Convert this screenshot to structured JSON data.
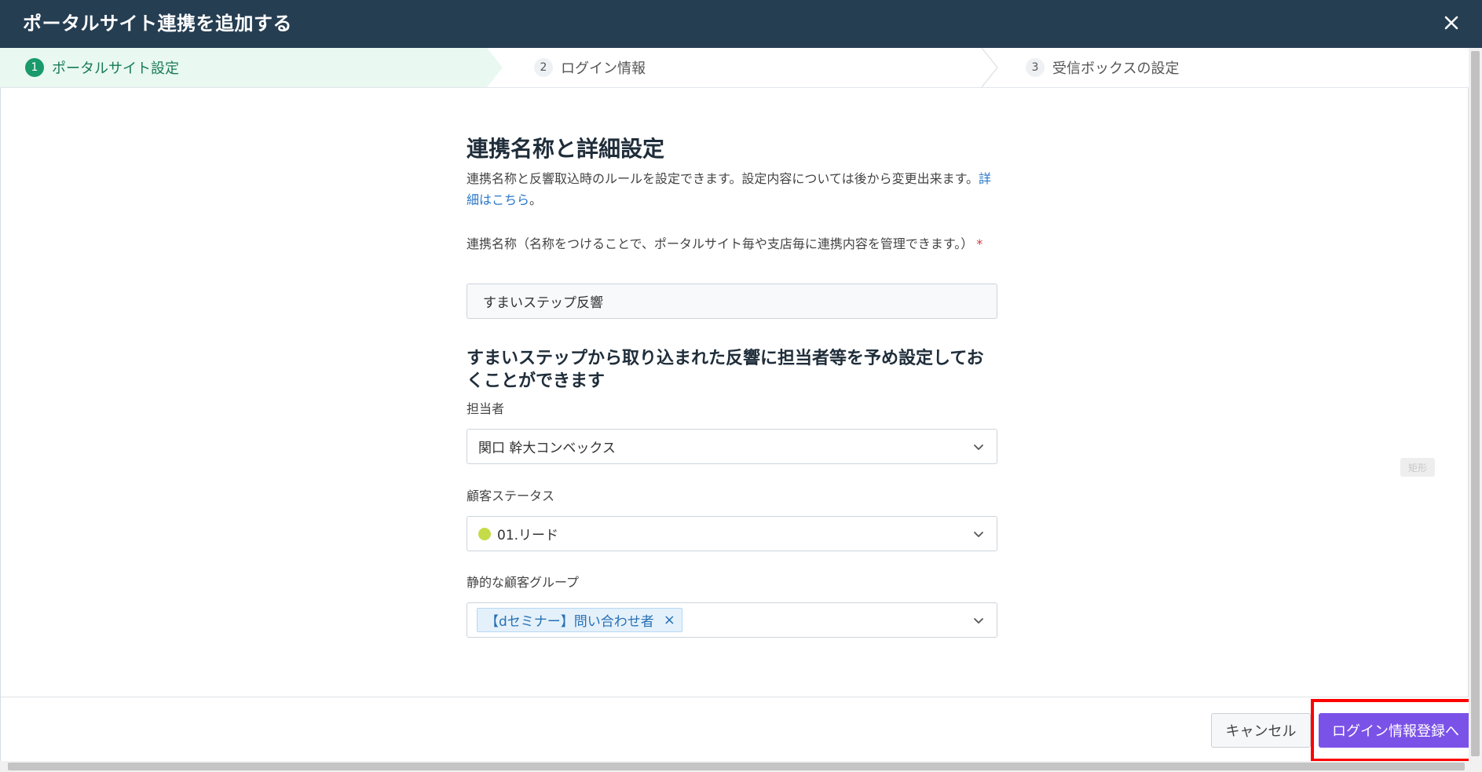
{
  "header": {
    "title": "ポータルサイト連携を追加する"
  },
  "stepper": {
    "steps": [
      {
        "number": "1",
        "label": "ポータルサイト設定"
      },
      {
        "number": "2",
        "label": "ログイン情報"
      },
      {
        "number": "3",
        "label": "受信ボックスの設定"
      }
    ]
  },
  "form": {
    "title": "連携名称と詳細設定",
    "description": "連携名称と反響取込時のルールを設定できます。設定内容については後から変更出来ます。",
    "detail_link": "詳細はこちら",
    "description_end": "。",
    "name_label": "連携名称（名称をつけることで、ポータルサイト毎や支店毎に連携内容を管理できます。）",
    "required_mark": "*",
    "name_value": "すまいステップ反響",
    "preset_heading": "すまいステップから取り込まれた反響に担当者等を予め設定しておくことができます",
    "assignee_label": "担当者",
    "assignee_value": "関口 幹大コンベックス",
    "status_label": "顧客ステータス",
    "status_value": "01.リード",
    "group_label": "静的な顧客グループ",
    "group_tag": "【dセミナー】問い合わせ者",
    "group_tag_close": "×"
  },
  "floating_badge": "矩形",
  "footer": {
    "cancel_label": "キャンセル",
    "next_label": "ログイン情報登録へ"
  },
  "colors": {
    "header_bg": "#263e52",
    "step_active_bg": "#e9f8f1",
    "step_active_accent": "#199a6b",
    "primary_button": "#7b52e8",
    "status_dot": "#c5dc48",
    "highlight": "#ff0000"
  }
}
